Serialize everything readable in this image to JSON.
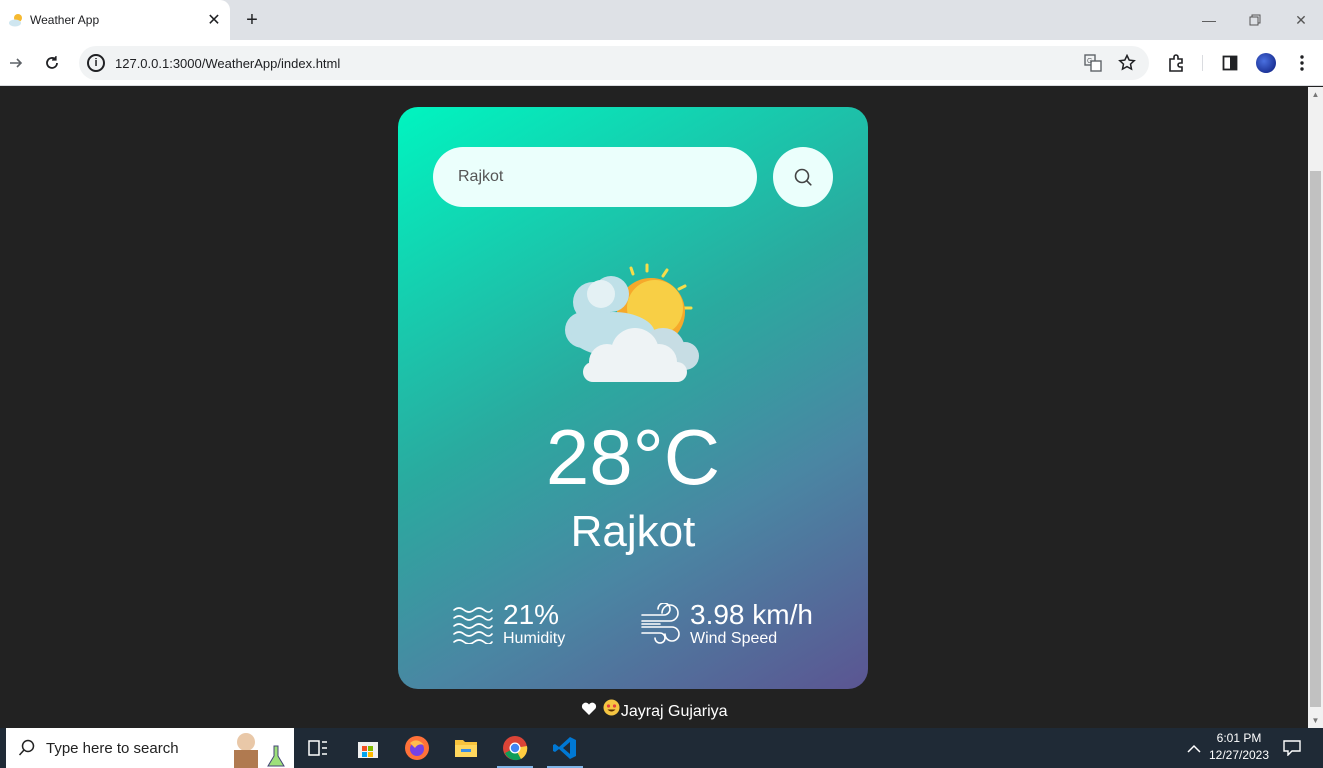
{
  "browser": {
    "tab_title": "Weather App",
    "new_tab_symbol": "+",
    "close_symbol": "✕",
    "url": "127.0.0.1:3000/WeatherApp/index.html"
  },
  "weather": {
    "search_value": "Rajkot",
    "temperature": "28°C",
    "city": "Rajkot",
    "condition_icon": "partly-cloudy-icon",
    "humidity_value": "21%",
    "humidity_label": "Humidity",
    "wind_value": "3.98 km/h",
    "wind_label": "Wind Speed"
  },
  "footer": {
    "author": "Jayraj Gujariya"
  },
  "taskbar": {
    "search_placeholder": "Type here to search",
    "time": "6:01 PM",
    "date": "12/27/2023"
  },
  "colors": {
    "card_gradient_start": "#00f5c0",
    "card_gradient_end": "#5b5592",
    "page_background": "#222222"
  }
}
